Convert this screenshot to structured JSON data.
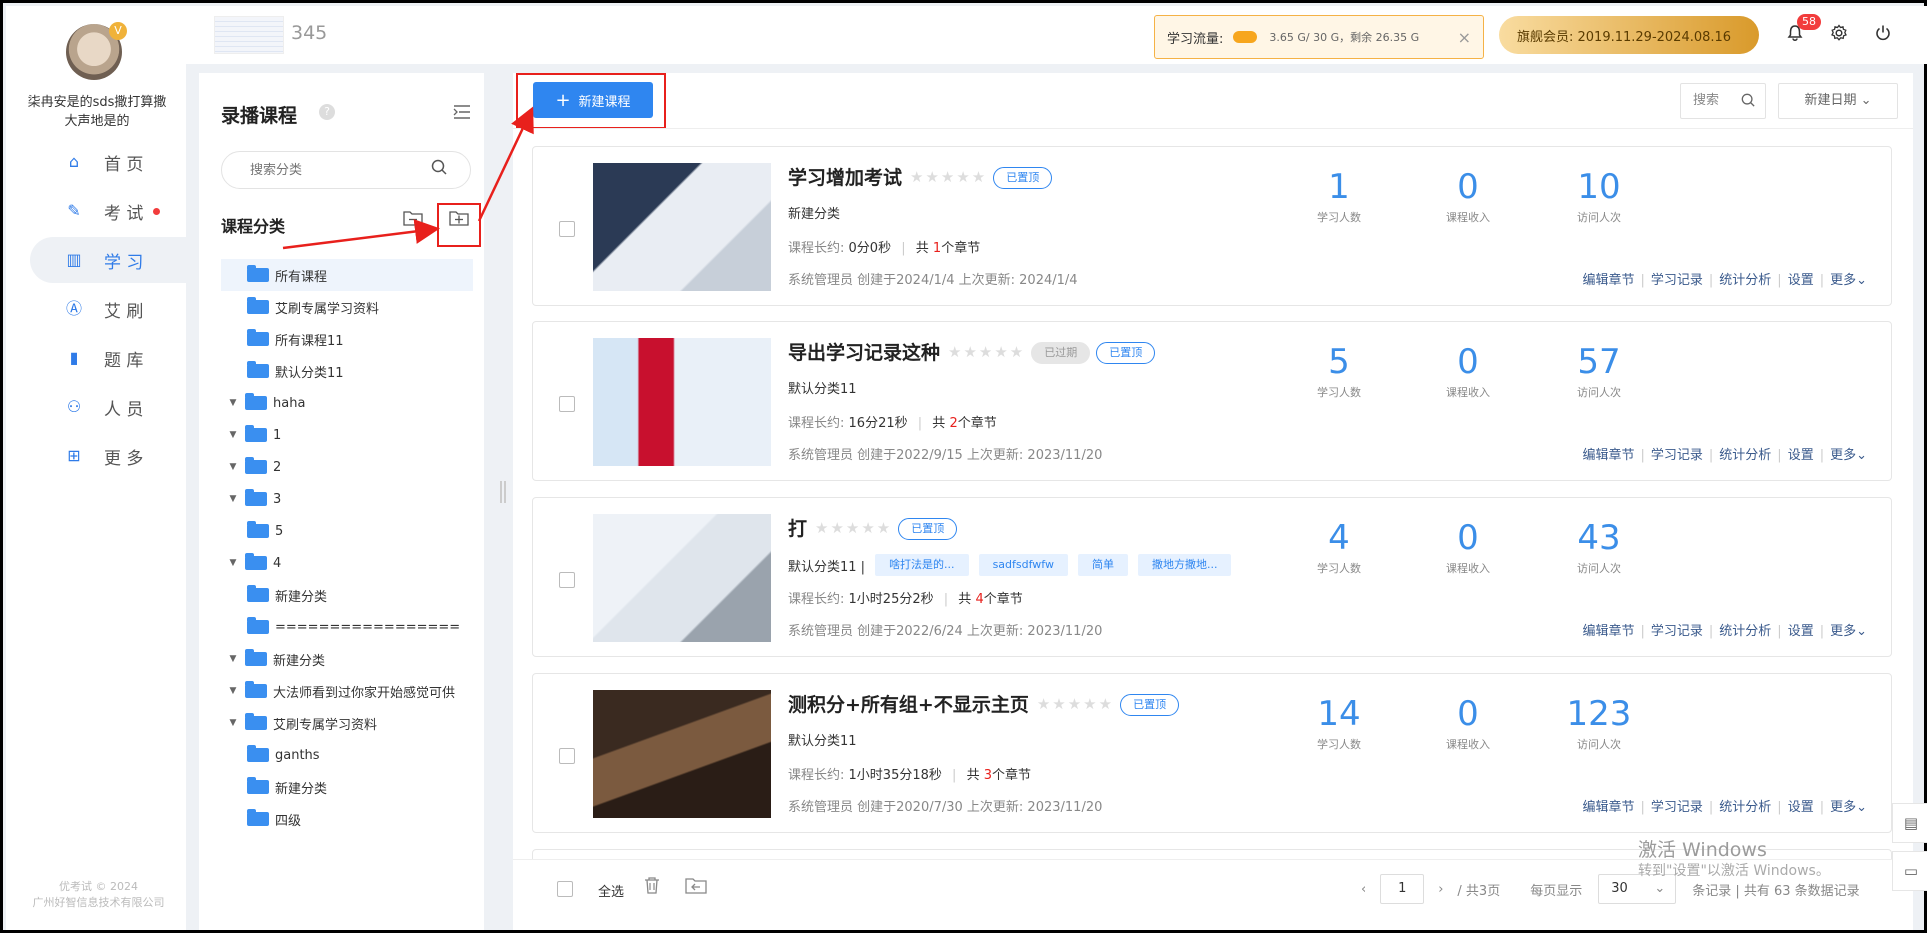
{
  "user": {
    "name": "柒冉安是的sds撒打算撒大声地是的",
    "vip_mark": "V"
  },
  "nav": [
    {
      "label": "首 页",
      "icon": "home-icon",
      "glyph": "⌂"
    },
    {
      "label": "考 试",
      "icon": "exam-icon",
      "glyph": "✎"
    },
    {
      "label": "学 习",
      "icon": "book-icon",
      "glyph": "▥"
    },
    {
      "label": "艾 刷",
      "icon": "brush-icon",
      "glyph": "Ⓐ"
    },
    {
      "label": "题 库",
      "icon": "question-bank-icon",
      "glyph": "▮"
    },
    {
      "label": "人 员",
      "icon": "person-icon",
      "glyph": "⚇"
    },
    {
      "label": "更 多",
      "icon": "more-grid-icon",
      "glyph": "⊞"
    }
  ],
  "copyright": {
    "line1": "优考试 © 2024",
    "line2": "广州好智信息技术有限公司"
  },
  "topbar": {
    "logo_text": "345",
    "flow_label": "学习流量:",
    "flow_detail": "3.65 G/ 30 G，剩余 26.35 G",
    "flow_close": "×",
    "member": "旗舰会员:  2019.11.29-2024.08.16",
    "bell_count": "58"
  },
  "category_panel": {
    "title": "录播课程",
    "help": "?",
    "search_placeholder": "搜索分类",
    "subtitle": "课程分类",
    "tree": [
      {
        "label": "所有课程",
        "level": 1,
        "arrow": ""
      },
      {
        "label": "艾刷专属学习资料",
        "level": 1,
        "arrow": ""
      },
      {
        "label": "所有课程11",
        "level": 1,
        "arrow": ""
      },
      {
        "label": "默认分类11",
        "level": 1,
        "arrow": ""
      },
      {
        "label": "haha",
        "level": 0,
        "arrow": "▼"
      },
      {
        "label": "1",
        "level": 0,
        "arrow": "▼"
      },
      {
        "label": "2",
        "level": 0,
        "arrow": "▼"
      },
      {
        "label": "3",
        "level": 0,
        "arrow": "▼"
      },
      {
        "label": "5",
        "level": 1,
        "arrow": ""
      },
      {
        "label": "4",
        "level": 0,
        "arrow": "▼"
      },
      {
        "label": "新建分类",
        "level": 1,
        "arrow": ""
      },
      {
        "label": "=================",
        "level": 1,
        "arrow": ""
      },
      {
        "label": "新建分类",
        "level": 0,
        "arrow": "▼"
      },
      {
        "label": "大法师看到过你家开始感觉可供",
        "level": 0,
        "arrow": "▼"
      },
      {
        "label": "艾刷专属学习资料",
        "level": 0,
        "arrow": "▼"
      },
      {
        "label": "ganths",
        "level": 1,
        "arrow": ""
      },
      {
        "label": "新建分类",
        "level": 1,
        "arrow": ""
      },
      {
        "label": "四级",
        "level": 1,
        "arrow": ""
      }
    ]
  },
  "main": {
    "new_button": "新建课程",
    "search": "搜索",
    "sort": "新建日期 ⌄",
    "stat_labels": {
      "learners": "学习人数",
      "income": "课程收入",
      "visits": "访问人次"
    },
    "actions": [
      "编辑章节",
      "学习记录",
      "统计分析",
      "设置",
      "更多⌄"
    ],
    "len_label": "课程长约:",
    "chapters_prefix": "共",
    "chapters_suffix": "个章节",
    "courses": [
      {
        "name": "学习增加考试",
        "expired": "",
        "pinned": "已置顶",
        "category": "新建分类",
        "chips": [],
        "duration": "0分0秒",
        "chapters": "1",
        "meta": "系统管理员  创建于2024/1/4  上次更新:  2024/1/4",
        "learners": "1",
        "income": "0",
        "visits": "10"
      },
      {
        "name": "导出学习记录这种",
        "expired": "已过期",
        "pinned": "已置顶",
        "category": "默认分类11",
        "chips": [],
        "duration": "16分21秒",
        "chapters": "2",
        "meta": "系统管理员  创建于2022/9/15  上次更新:  2023/11/20",
        "learners": "5",
        "income": "0",
        "visits": "57"
      },
      {
        "name": "打",
        "expired": "",
        "pinned": "已置顶",
        "category": "默认分类11 |",
        "chips": [
          "啥打法是的...",
          "sadfsdfwfw",
          "简单",
          "撒地方撒地..."
        ],
        "duration": "1小时25分2秒",
        "chapters": "4",
        "meta": "系统管理员  创建于2022/6/24  上次更新:  2023/11/20",
        "learners": "4",
        "income": "0",
        "visits": "43"
      },
      {
        "name": "测积分+所有组+不显示主页",
        "expired": "",
        "pinned": "已置顶",
        "category": "默认分类11",
        "chips": [],
        "duration": "1小时35分18秒",
        "chapters": "3",
        "meta": "系统管理员  创建于2020/7/30  上次更新:  2023/11/20",
        "learners": "14",
        "income": "0",
        "visits": "123"
      }
    ]
  },
  "footer": {
    "select_all": "全选",
    "page": "1",
    "total_pages": "/ 共3页",
    "per_page_label": "每页显示",
    "per_page": "30",
    "records": "条记录 | 共有 63 条数据记录"
  },
  "watermark": {
    "line1": "激活 Windows",
    "line2": "转到\"设置\"以激活 Windows。"
  }
}
